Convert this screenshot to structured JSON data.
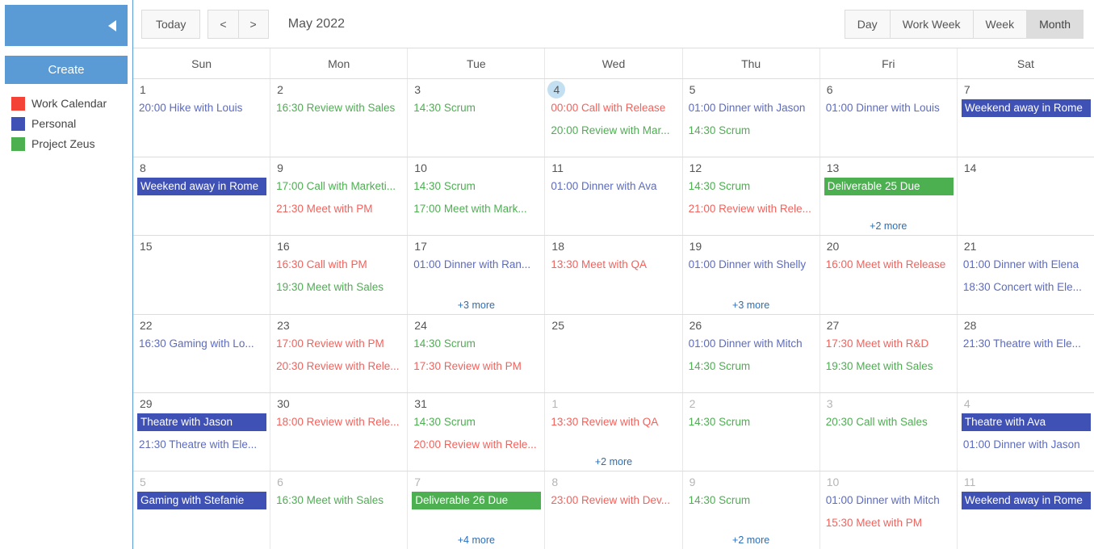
{
  "sidebar": {
    "collapse_icon": "caret-left-icon",
    "create_label": "Create",
    "legend": [
      {
        "label": "Work Calendar",
        "color": "#f44336"
      },
      {
        "label": "Personal",
        "color": "#3f51b5"
      },
      {
        "label": "Project Zeus",
        "color": "#4caf50"
      }
    ]
  },
  "toolbar": {
    "today_label": "Today",
    "prev_label": "<",
    "next_label": ">",
    "title": "May 2022",
    "views": [
      {
        "label": "Day",
        "active": false
      },
      {
        "label": "Work Week",
        "active": false
      },
      {
        "label": "Week",
        "active": false
      },
      {
        "label": "Month",
        "active": true
      }
    ]
  },
  "calendar": {
    "weekdays": [
      "Sun",
      "Mon",
      "Tue",
      "Wed",
      "Thu",
      "Fri",
      "Sat"
    ],
    "colors": {
      "work": "#f44336",
      "personal": "#3f51b5",
      "project": "#4caf50",
      "allday_personal_bg": "#3f51b5",
      "allday_project_bg": "#4caf50",
      "today_bg": "#c3dff2",
      "more_link": "#2a6ebb"
    },
    "weeks": [
      [
        {
          "day": "1",
          "other": false,
          "today": false,
          "events": [
            {
              "text": "20:00 Hike with Louis",
              "type": "timed",
              "color": "#5c6bc0"
            }
          ],
          "more": ""
        },
        {
          "day": "2",
          "other": false,
          "today": false,
          "events": [
            {
              "text": "16:30 Review with Sales",
              "type": "timed",
              "color": "#4caf50"
            }
          ],
          "more": ""
        },
        {
          "day": "3",
          "other": false,
          "today": false,
          "events": [
            {
              "text": "14:30 Scrum",
              "type": "timed",
              "color": "#4caf50"
            }
          ],
          "more": ""
        },
        {
          "day": "4",
          "other": false,
          "today": true,
          "events": [
            {
              "text": "00:00 Call with Release",
              "type": "timed",
              "color": "#f4615b"
            },
            {
              "text": "20:00 Review with Mar...",
              "type": "timed",
              "color": "#4caf50"
            }
          ],
          "more": ""
        },
        {
          "day": "5",
          "other": false,
          "today": false,
          "events": [
            {
              "text": "01:00 Dinner with Jason",
              "type": "timed",
              "color": "#5c6bc0"
            },
            {
              "text": "14:30 Scrum",
              "type": "timed",
              "color": "#4caf50"
            }
          ],
          "more": ""
        },
        {
          "day": "6",
          "other": false,
          "today": false,
          "events": [
            {
              "text": "01:00 Dinner with Louis",
              "type": "timed",
              "color": "#5c6bc0"
            }
          ],
          "more": ""
        },
        {
          "day": "7",
          "other": false,
          "today": false,
          "events": [
            {
              "text": "Weekend away in Rome",
              "type": "allday",
              "color": "#3f51b5"
            }
          ],
          "more": ""
        }
      ],
      [
        {
          "day": "8",
          "other": false,
          "today": false,
          "events": [
            {
              "text": "Weekend away in Rome",
              "type": "allday",
              "color": "#3f51b5"
            }
          ],
          "more": ""
        },
        {
          "day": "9",
          "other": false,
          "today": false,
          "events": [
            {
              "text": "17:00 Call with Marketi...",
              "type": "timed",
              "color": "#4caf50"
            },
            {
              "text": "21:30 Meet with PM",
              "type": "timed",
              "color": "#f4615b"
            }
          ],
          "more": ""
        },
        {
          "day": "10",
          "other": false,
          "today": false,
          "events": [
            {
              "text": "14:30 Scrum",
              "type": "timed",
              "color": "#4caf50"
            },
            {
              "text": "17:00 Meet with Mark...",
              "type": "timed",
              "color": "#4caf50"
            }
          ],
          "more": ""
        },
        {
          "day": "11",
          "other": false,
          "today": false,
          "events": [
            {
              "text": "01:00 Dinner with Ava",
              "type": "timed",
              "color": "#5c6bc0"
            }
          ],
          "more": ""
        },
        {
          "day": "12",
          "other": false,
          "today": false,
          "events": [
            {
              "text": "14:30 Scrum",
              "type": "timed",
              "color": "#4caf50"
            },
            {
              "text": "21:00 Review with Rele...",
              "type": "timed",
              "color": "#f4615b"
            }
          ],
          "more": ""
        },
        {
          "day": "13",
          "other": false,
          "today": false,
          "events": [
            {
              "text": "Deliverable 25 Due",
              "type": "allday",
              "color": "#4caf50"
            }
          ],
          "more": "+2 more"
        },
        {
          "day": "14",
          "other": false,
          "today": false,
          "events": [],
          "more": ""
        }
      ],
      [
        {
          "day": "15",
          "other": false,
          "today": false,
          "events": [],
          "more": ""
        },
        {
          "day": "16",
          "other": false,
          "today": false,
          "events": [
            {
              "text": "16:30 Call with PM",
              "type": "timed",
              "color": "#f4615b"
            },
            {
              "text": "19:30 Meet with Sales",
              "type": "timed",
              "color": "#4caf50"
            }
          ],
          "more": ""
        },
        {
          "day": "17",
          "other": false,
          "today": false,
          "events": [
            {
              "text": "01:00 Dinner with Ran...",
              "type": "timed",
              "color": "#5c6bc0"
            }
          ],
          "more": "+3 more"
        },
        {
          "day": "18",
          "other": false,
          "today": false,
          "events": [
            {
              "text": "13:30 Meet with QA",
              "type": "timed",
              "color": "#f4615b"
            }
          ],
          "more": ""
        },
        {
          "day": "19",
          "other": false,
          "today": false,
          "events": [
            {
              "text": "01:00 Dinner with Shelly",
              "type": "timed",
              "color": "#5c6bc0"
            }
          ],
          "more": "+3 more"
        },
        {
          "day": "20",
          "other": false,
          "today": false,
          "events": [
            {
              "text": "16:00 Meet with Release",
              "type": "timed",
              "color": "#f4615b"
            }
          ],
          "more": ""
        },
        {
          "day": "21",
          "other": false,
          "today": false,
          "events": [
            {
              "text": "01:00 Dinner with Elena",
              "type": "timed",
              "color": "#5c6bc0"
            },
            {
              "text": "18:30 Concert with Ele...",
              "type": "timed",
              "color": "#5c6bc0"
            }
          ],
          "more": ""
        }
      ],
      [
        {
          "day": "22",
          "other": false,
          "today": false,
          "events": [
            {
              "text": "16:30 Gaming with Lo...",
              "type": "timed",
              "color": "#5c6bc0"
            }
          ],
          "more": ""
        },
        {
          "day": "23",
          "other": false,
          "today": false,
          "events": [
            {
              "text": "17:00 Review with PM",
              "type": "timed",
              "color": "#f4615b"
            },
            {
              "text": "20:30 Review with Rele...",
              "type": "timed",
              "color": "#f4615b"
            }
          ],
          "more": ""
        },
        {
          "day": "24",
          "other": false,
          "today": false,
          "events": [
            {
              "text": "14:30 Scrum",
              "type": "timed",
              "color": "#4caf50"
            },
            {
              "text": "17:30 Review with PM",
              "type": "timed",
              "color": "#f4615b"
            }
          ],
          "more": ""
        },
        {
          "day": "25",
          "other": false,
          "today": false,
          "events": [],
          "more": ""
        },
        {
          "day": "26",
          "other": false,
          "today": false,
          "events": [
            {
              "text": "01:00 Dinner with Mitch",
              "type": "timed",
              "color": "#5c6bc0"
            },
            {
              "text": "14:30 Scrum",
              "type": "timed",
              "color": "#4caf50"
            }
          ],
          "more": ""
        },
        {
          "day": "27",
          "other": false,
          "today": false,
          "events": [
            {
              "text": "17:30 Meet with R&D",
              "type": "timed",
              "color": "#f4615b"
            },
            {
              "text": "19:30 Meet with Sales",
              "type": "timed",
              "color": "#4caf50"
            }
          ],
          "more": ""
        },
        {
          "day": "28",
          "other": false,
          "today": false,
          "events": [
            {
              "text": "21:30 Theatre with Ele...",
              "type": "timed",
              "color": "#5c6bc0"
            }
          ],
          "more": ""
        }
      ],
      [
        {
          "day": "29",
          "other": false,
          "today": false,
          "events": [
            {
              "text": "Theatre with Jason",
              "type": "allday",
              "color": "#3f51b5"
            },
            {
              "text": "21:30 Theatre with Ele...",
              "type": "timed",
              "color": "#5c6bc0"
            }
          ],
          "more": ""
        },
        {
          "day": "30",
          "other": false,
          "today": false,
          "events": [
            {
              "text": "18:00 Review with Rele...",
              "type": "timed",
              "color": "#f4615b"
            }
          ],
          "more": ""
        },
        {
          "day": "31",
          "other": false,
          "today": false,
          "events": [
            {
              "text": "14:30 Scrum",
              "type": "timed",
              "color": "#4caf50"
            },
            {
              "text": "20:00 Review with Rele...",
              "type": "timed",
              "color": "#f4615b"
            }
          ],
          "more": ""
        },
        {
          "day": "1",
          "other": true,
          "today": false,
          "events": [
            {
              "text": "13:30 Review with QA",
              "type": "timed",
              "color": "#f4615b"
            }
          ],
          "more": "+2 more"
        },
        {
          "day": "2",
          "other": true,
          "today": false,
          "events": [
            {
              "text": "14:30 Scrum",
              "type": "timed",
              "color": "#4caf50"
            }
          ],
          "more": ""
        },
        {
          "day": "3",
          "other": true,
          "today": false,
          "events": [
            {
              "text": "20:30 Call with Sales",
              "type": "timed",
              "color": "#4caf50"
            }
          ],
          "more": ""
        },
        {
          "day": "4",
          "other": true,
          "today": false,
          "events": [
            {
              "text": "Theatre with Ava",
              "type": "allday",
              "color": "#3f51b5"
            },
            {
              "text": "01:00 Dinner with Jason",
              "type": "timed",
              "color": "#5c6bc0"
            }
          ],
          "more": ""
        }
      ],
      [
        {
          "day": "5",
          "other": true,
          "today": false,
          "events": [
            {
              "text": "Gaming with Stefanie",
              "type": "allday",
              "color": "#3f51b5"
            }
          ],
          "more": ""
        },
        {
          "day": "6",
          "other": true,
          "today": false,
          "events": [
            {
              "text": "16:30 Meet with Sales",
              "type": "timed",
              "color": "#4caf50"
            }
          ],
          "more": ""
        },
        {
          "day": "7",
          "other": true,
          "today": false,
          "events": [
            {
              "text": "Deliverable 26 Due",
              "type": "allday",
              "color": "#4caf50"
            }
          ],
          "more": "+4 more"
        },
        {
          "day": "8",
          "other": true,
          "today": false,
          "events": [
            {
              "text": "23:00 Review with Dev...",
              "type": "timed",
              "color": "#f4615b"
            }
          ],
          "more": ""
        },
        {
          "day": "9",
          "other": true,
          "today": false,
          "events": [
            {
              "text": "14:30 Scrum",
              "type": "timed",
              "color": "#4caf50"
            }
          ],
          "more": "+2 more"
        },
        {
          "day": "10",
          "other": true,
          "today": false,
          "events": [
            {
              "text": "01:00 Dinner with Mitch",
              "type": "timed",
              "color": "#5c6bc0"
            },
            {
              "text": "15:30 Meet with PM",
              "type": "timed",
              "color": "#f4615b"
            }
          ],
          "more": ""
        },
        {
          "day": "11",
          "other": true,
          "today": false,
          "events": [
            {
              "text": "Weekend away in Rome",
              "type": "allday",
              "color": "#3f51b5"
            }
          ],
          "more": ""
        }
      ]
    ]
  }
}
